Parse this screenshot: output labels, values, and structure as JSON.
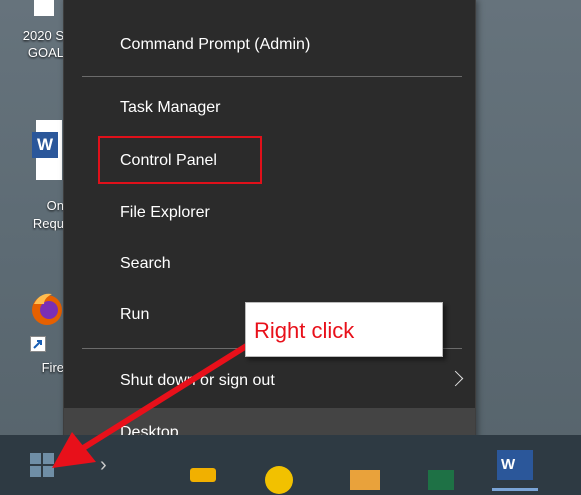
{
  "desktop": {
    "icons": [
      {
        "label_line1": "2020 S",
        "label_line2": "GOAL"
      },
      {
        "label_line1": "On",
        "label_line2": "Requ"
      },
      {
        "label_line1": "Fire",
        "label_line2": ""
      }
    ],
    "word_icon_letter": "W"
  },
  "menu": {
    "items": [
      {
        "label": "Command Prompt (Admin)"
      },
      {
        "label": "Task Manager"
      },
      {
        "label": "Control Panel"
      },
      {
        "label": "File Explorer"
      },
      {
        "label": "Search"
      },
      {
        "label": "Run"
      },
      {
        "label": "Shut down or sign out"
      },
      {
        "label": "Desktop"
      }
    ]
  },
  "annotation": {
    "callout_text": "Right click",
    "highlight_color": "#e0101a",
    "arrow_color": "#e8101a"
  },
  "taskbar": {
    "word_letter": "W"
  },
  "colors": {
    "menu_bg": "#2b2b2b",
    "taskbar_bg": "#2e3a43",
    "desktop_bg": "#5f6e78"
  }
}
